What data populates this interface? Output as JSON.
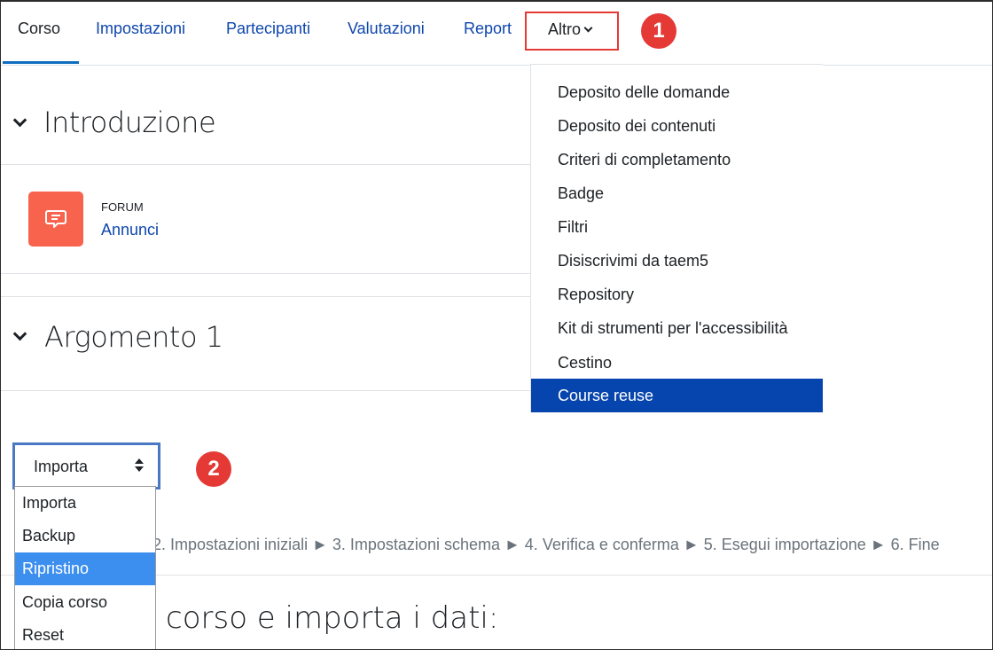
{
  "nav": {
    "tabs": [
      {
        "label": "Corso"
      },
      {
        "label": "Impostazioni"
      },
      {
        "label": "Partecipanti"
      },
      {
        "label": "Valutazioni"
      },
      {
        "label": "Report"
      }
    ],
    "more_label": "Altro"
  },
  "callouts": [
    "1",
    "2"
  ],
  "sections": [
    {
      "title": "Introduzione"
    },
    {
      "title": "Argomento 1"
    }
  ],
  "forum": {
    "type_label": "FORUM",
    "name": "Annunci",
    "icon": "forum-icon"
  },
  "more_menu": {
    "items": [
      "Deposito delle domande",
      "Deposito dei contenuti",
      "Criteri di completamento",
      "Badge",
      "Filtri",
      "Disiscrivimi da taem5",
      "Repository",
      "Kit di strumenti per l'accessibilità",
      "Cestino",
      "Course reuse"
    ],
    "selected": "Course reuse"
  },
  "reuse_select": {
    "value": "Importa",
    "options": [
      "Importa",
      "Backup",
      "Ripristino",
      "Copia corso",
      "Reset"
    ],
    "highlighted": "Ripristino"
  },
  "steps_text": "2. Impostazioni iniziali ► 3. Impostazioni schema ► 4. Verifica e conferma ► 5. Esegui importazione ► 6. Fine",
  "heading_partial": "corso e importa i dati:",
  "colors": {
    "accent": "#0f47ad",
    "selected_menu": "#0645ad",
    "callout": "#e53935",
    "forum_icon_bg": "#f7634d",
    "listbox_selected": "#3d8fef"
  }
}
